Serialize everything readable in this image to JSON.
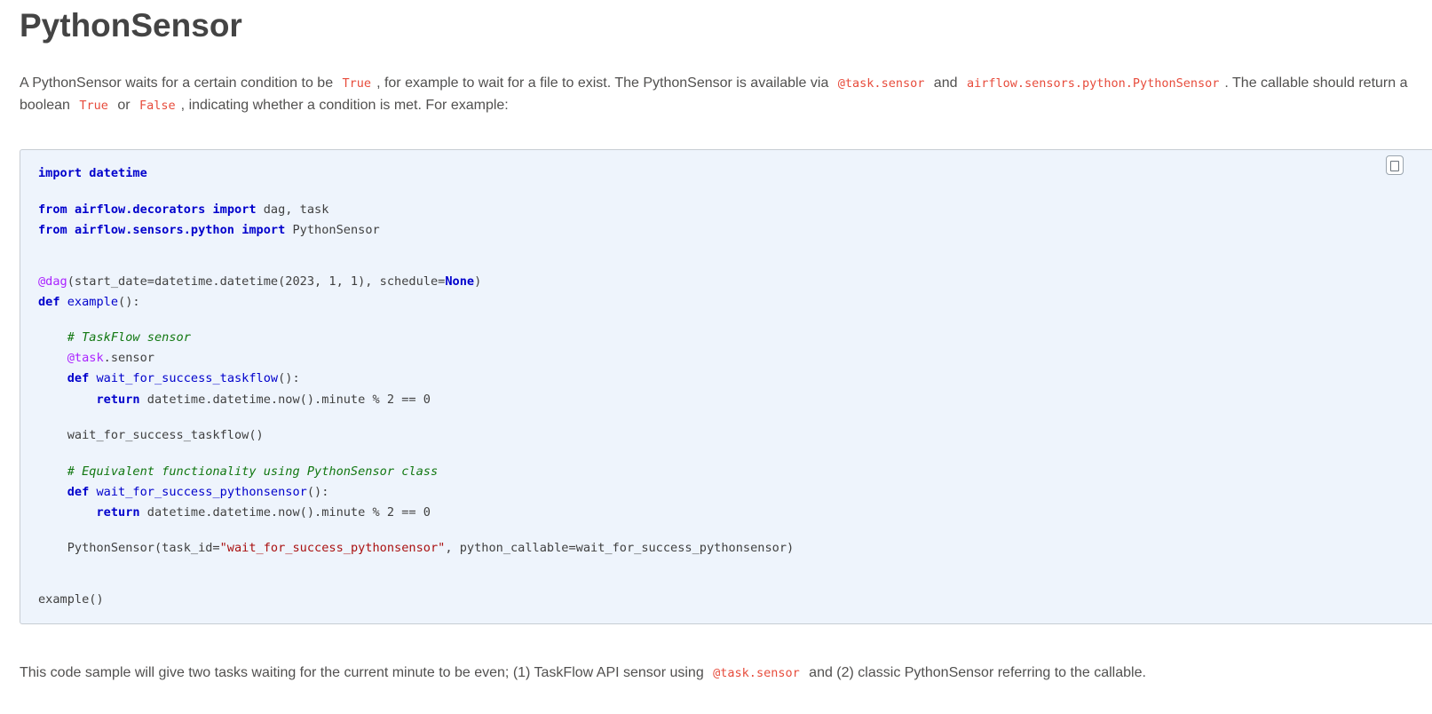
{
  "heading": "PythonSensor",
  "intro": {
    "line1_a": "A PythonSensor waits for a certain condition to be ",
    "code_true": "True",
    "line1_b": ", for example to wait for a file to exist. The PythonSensor is available via ",
    "code_task_sensor": "@task.sensor",
    "line1_and": " and ",
    "code_class_path": "airflow.sensors.python.PythonSensor",
    "line1_c": ". The callable should return a",
    "line2_a": "boolean ",
    "code_true2": "True",
    "line2_or": " or ",
    "code_false": "False",
    "line2_b": ", indicating whether a condition is met. For example:"
  },
  "code": {
    "l1_import": "import",
    "l1_mod": "datetime",
    "l2_from": "from",
    "l2_mod": "airflow.decorators",
    "l2_import": "import",
    "l2_rest": "dag, task",
    "l3_from": "from",
    "l3_mod": "airflow.sensors.python",
    "l3_import": "import",
    "l3_rest": "PythonSensor",
    "l4_dec": "@dag",
    "l4_rest": "(start_date=datetime.datetime(2023, 1, 1), schedule=",
    "l4_none": "None",
    "l4_end": ")",
    "l5_def": "def",
    "l5_fn": "example",
    "l5_rest": "():",
    "l6_comment": "# TaskFlow sensor",
    "l7_dec": "@task",
    "l7_rest": ".sensor",
    "l8_def": "def",
    "l8_fn": "wait_for_success_taskflow",
    "l8_rest": "():",
    "l9_return": "return",
    "l9_rest": "datetime.datetime.now().minute % 2 == 0",
    "l10": "wait_for_success_taskflow()",
    "l11_comment": "# Equivalent functionality using PythonSensor class",
    "l12_def": "def",
    "l12_fn": "wait_for_success_pythonsensor",
    "l12_rest": "():",
    "l13_return": "return",
    "l13_rest": "datetime.datetime.now().minute % 2 == 0",
    "l14_a": "PythonSensor(task_id=",
    "l14_str": "\"wait_for_success_pythonsensor\"",
    "l14_b": ", python_callable=wait_for_success_pythonsensor)",
    "l15": "example()"
  },
  "outro": {
    "text_a": "This code sample will give two tasks waiting for the current minute to be even; (1) TaskFlow API sensor using ",
    "code_task_sensor": "@task.sensor",
    "text_b": " and (2) classic PythonSensor referring to the callable."
  },
  "icons": {
    "copy": "copy-icon"
  },
  "colors": {
    "keyword": "#0000cc",
    "decorator": "#aa22ff",
    "comment": "#117711",
    "string": "#aa1111",
    "inline_code": "#e74c3c",
    "code_background": "#eef4fc"
  }
}
